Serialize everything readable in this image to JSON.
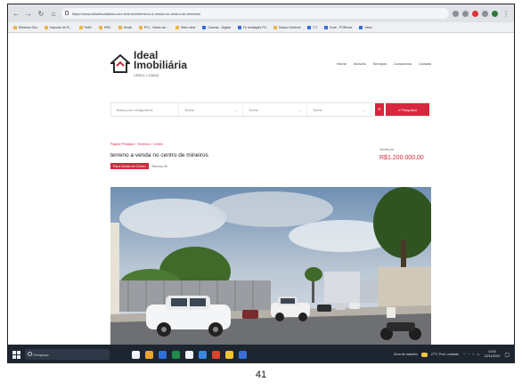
{
  "browser": {
    "url": "https://www.idealimobiliaria.com.br/imovel/terreno-a-venda-no-centro-de-mineiros",
    "bookmarks": [
      "Mineiros Gov",
      "Imposto de R...",
      "SIAD",
      "RBC",
      "Gmail",
      "PCI - Vistos de...",
      "Sites úteis",
      "Canvas - Digital",
      "Fri Avaliação PC",
      "Banco Ombrod",
      "CT",
      "Kodr - PCBreve",
      "Vetor"
    ]
  },
  "site": {
    "logo_line1": "Ideal",
    "logo_line2": "Imobiliária",
    "creci": "CRECI J 12600",
    "nav": [
      "Home",
      "Imóveis",
      "Serviços",
      "Consórcios",
      "Contato"
    ]
  },
  "search": {
    "code_placeholder": "Busca por código/título",
    "select1": "Todos",
    "select2": "Todos",
    "select3": "Todos",
    "filter_label": "≡",
    "search_label": "⌕ Pesquisar"
  },
  "listing": {
    "breadcrumb": "Página Principal > Terrenos > Centro",
    "title": "terreno a venda no centro de mineiros",
    "tag_sale": "Para Venda em Centro",
    "tag_ref": "Terreno 20",
    "price_label": "Venda por",
    "price": "R$1.200.000,00"
  },
  "taskbar": {
    "search_placeholder": "Pesquisar",
    "weather": "27°C  Pred. nublado",
    "notifications": "Área de trabalho",
    "time": "14:02",
    "date": "22/11/2023"
  },
  "page_number": "41"
}
